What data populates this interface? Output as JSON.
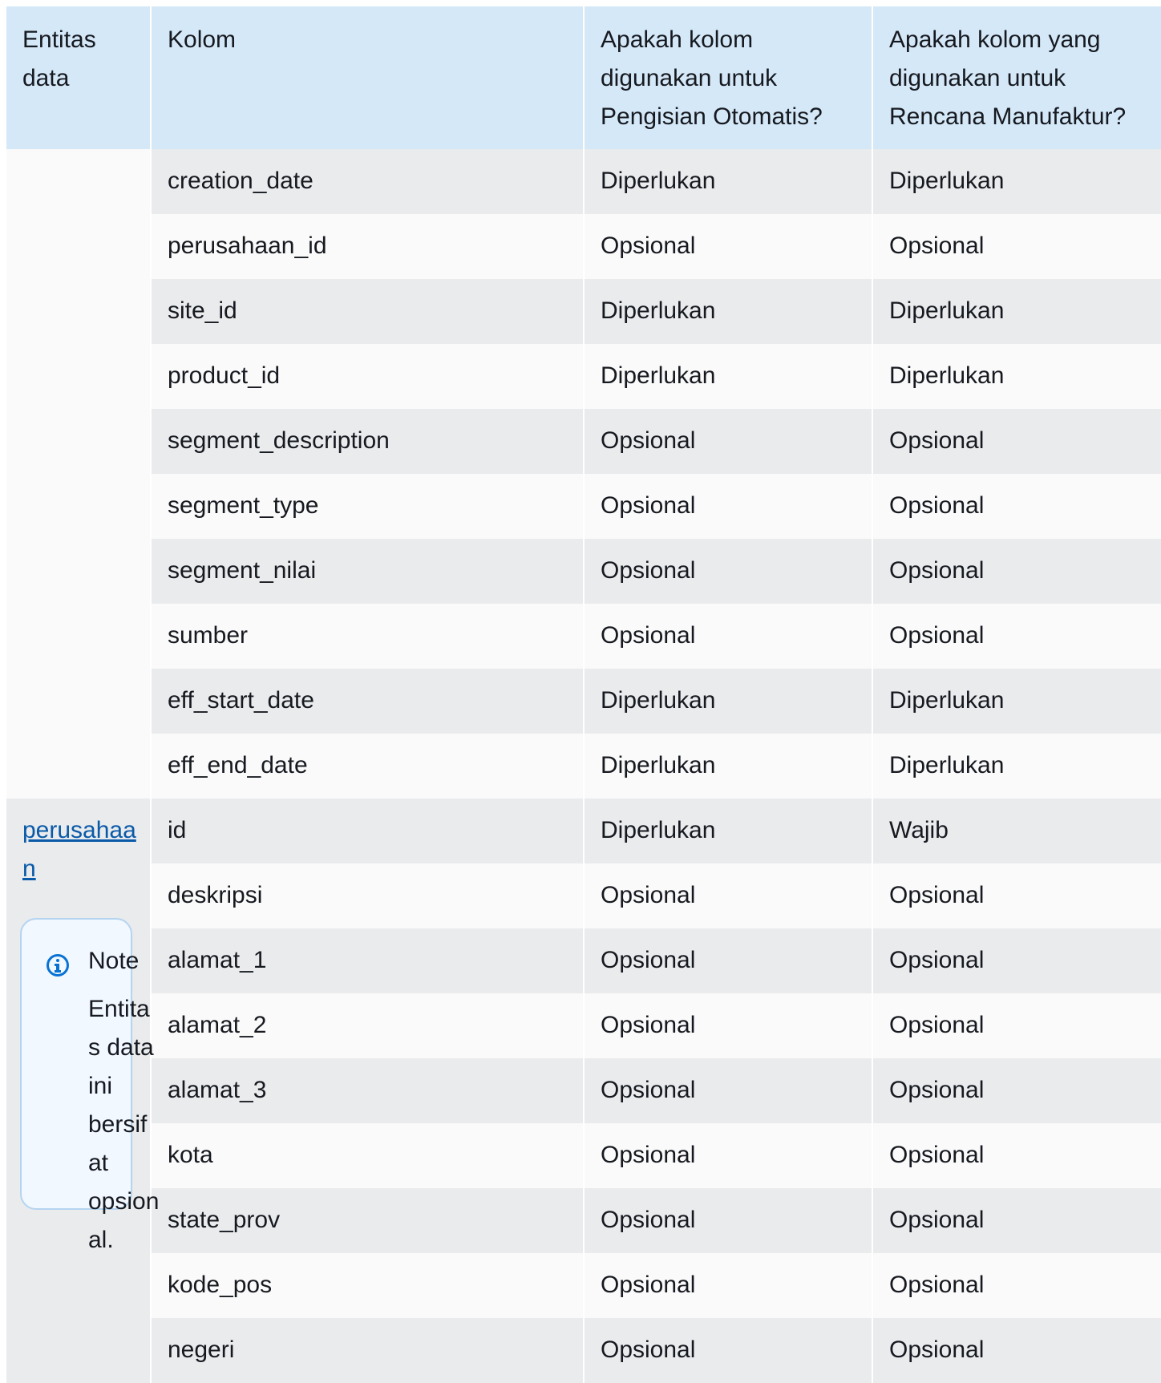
{
  "table": {
    "headers": [
      "Entitas data",
      "Kolom",
      "Apakah kolom digunakan untuk Pengisian Otomatis?",
      "Apakah kolom yang digunakan untuk Rencana Manufaktur?"
    ],
    "groups": [
      {
        "entity": "",
        "rows": [
          [
            "creation_date",
            "Diperlukan",
            "Diperlukan"
          ],
          [
            "perusahaan_id",
            "Opsional",
            "Opsional"
          ],
          [
            "site_id",
            "Diperlukan",
            "Diperlukan"
          ],
          [
            "product_id",
            "Diperlukan",
            "Diperlukan"
          ],
          [
            "segment_description",
            "Opsional",
            "Opsional"
          ],
          [
            "segment_type",
            "Opsional",
            "Opsional"
          ],
          [
            "segment_nilai",
            "Opsional",
            "Opsional"
          ],
          [
            "sumber",
            "Opsional",
            "Opsional"
          ],
          [
            "eff_start_date",
            "Diperlukan",
            "Diperlukan"
          ],
          [
            "eff_end_date",
            "Diperlukan",
            "Diperlukan"
          ]
        ]
      },
      {
        "entity": "perusahaan",
        "rows": [
          [
            "id",
            "Diperlukan",
            "Wajib"
          ],
          [
            "deskripsi",
            "Opsional",
            "Opsional"
          ],
          [
            "alamat_1",
            "Opsional",
            "Opsional"
          ],
          [
            "alamat_2",
            "Opsional",
            "Opsional"
          ],
          [
            "alamat_3",
            "Opsional",
            "Opsional"
          ],
          [
            "kota",
            "Opsional",
            "Opsional"
          ],
          [
            "state_prov",
            "Opsional",
            "Opsional"
          ],
          [
            "kode_pos",
            "Opsional",
            "Opsional"
          ],
          [
            "negeri",
            "Opsional",
            "Opsional"
          ]
        ]
      }
    ]
  },
  "note": {
    "icon": "info-icon",
    "title": "Note",
    "body": "Entitas data ini bersifat opsional."
  },
  "colors": {
    "header_bg": "#d5e8f8",
    "row_alt_bg": "#e9ebed",
    "row_bg": "#fafafa",
    "link": "#0a5aa8",
    "note_border": "#b5d4f0",
    "note_icon": "#0972d3"
  }
}
